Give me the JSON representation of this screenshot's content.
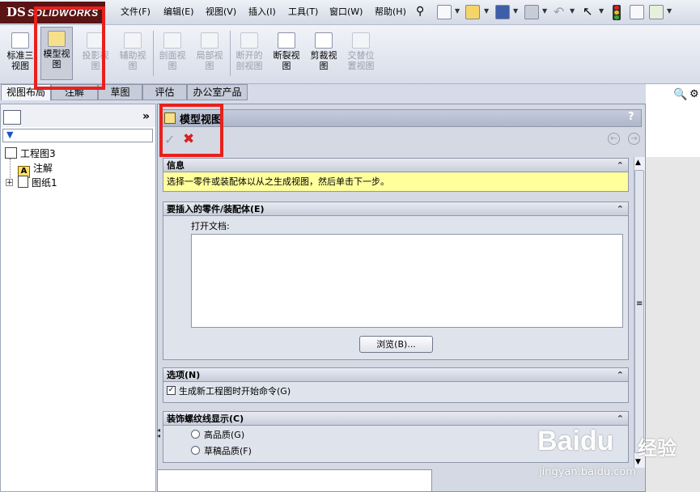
{
  "logo": {
    "mark": "DS",
    "text": "SOLIDWORKS"
  },
  "menu": [
    "文件(F)",
    "编辑(E)",
    "视图(V)",
    "插入(I)",
    "工具(T)",
    "窗口(W)",
    "帮助(H)"
  ],
  "commands": [
    {
      "label_l1": "标准三",
      "label_l2": "视图",
      "state": "normal"
    },
    {
      "label_l1": "模型视",
      "label_l2": "图",
      "state": "active"
    },
    {
      "label_l1": "投影视",
      "label_l2": "图",
      "state": "disabled"
    },
    {
      "label_l1": "辅助视",
      "label_l2": "图",
      "state": "disabled"
    },
    {
      "label_l1": "剖面视",
      "label_l2": "图",
      "state": "disabled"
    },
    {
      "label_l1": "局部视",
      "label_l2": "图",
      "state": "disabled"
    },
    {
      "label_l1": "断开的",
      "label_l2": "剖视图",
      "state": "disabled"
    },
    {
      "label_l1": "断裂视",
      "label_l2": "图",
      "state": "normal"
    },
    {
      "label_l1": "剪裁视",
      "label_l2": "图",
      "state": "normal"
    },
    {
      "label_l1": "交替位",
      "label_l2": "置视图",
      "state": "disabled"
    }
  ],
  "tabs": [
    "视图布局",
    "注解",
    "草图",
    "评估",
    "办公室产品"
  ],
  "tree": {
    "root": "工程图3",
    "items": [
      "注解",
      "图纸1"
    ]
  },
  "pm": {
    "title": "模型视图",
    "help": "?",
    "info": {
      "header": "信息",
      "message": "选择一零件或装配体以从之生成视图，然后单击下一步。"
    },
    "insert": {
      "header": "要插入的零件/装配体(E)",
      "open_docs_label": "打开文档:",
      "browse": "浏览(B)..."
    },
    "options": {
      "header": "选项(N)",
      "checkbox_label": "生成新工程图时开始命令(G)",
      "checked": true
    },
    "cosmetic": {
      "header": "装饰螺纹线显示(C)",
      "radio1": "高品质(G)",
      "radio2": "草稿品质(F)"
    }
  },
  "watermark": {
    "brand": "Baidu",
    "cn": "经验",
    "url": "jingyan.baidu.com"
  },
  "colors": {
    "highlight": "#e8201c",
    "info_bg": "#ffff9c",
    "logo_bg": "#5a1414"
  }
}
